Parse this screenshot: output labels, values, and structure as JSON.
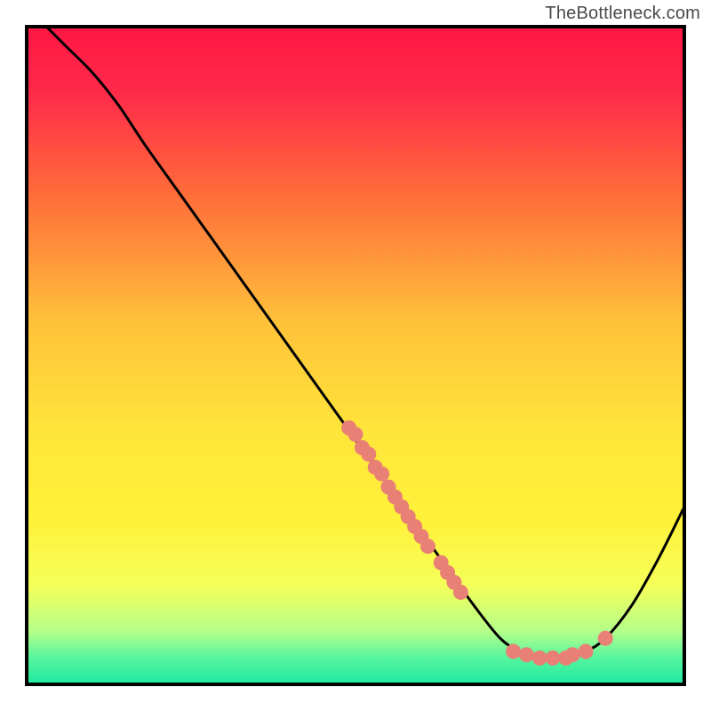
{
  "watermark": "TheBottleneck.com",
  "chart_data": {
    "type": "line",
    "title": "",
    "xlabel": "",
    "ylabel": "",
    "xlim": [
      0,
      100
    ],
    "ylim": [
      0,
      100
    ],
    "background": "rainbow-vertical-red-to-green",
    "curve": [
      {
        "x": 3,
        "y": 100
      },
      {
        "x": 6,
        "y": 97
      },
      {
        "x": 10,
        "y": 93
      },
      {
        "x": 14,
        "y": 88
      },
      {
        "x": 18,
        "y": 82
      },
      {
        "x": 23,
        "y": 75
      },
      {
        "x": 28,
        "y": 68
      },
      {
        "x": 33,
        "y": 61
      },
      {
        "x": 38,
        "y": 54
      },
      {
        "x": 43,
        "y": 47
      },
      {
        "x": 48,
        "y": 40
      },
      {
        "x": 53,
        "y": 33
      },
      {
        "x": 58,
        "y": 26
      },
      {
        "x": 63,
        "y": 19
      },
      {
        "x": 68,
        "y": 12
      },
      {
        "x": 72,
        "y": 7
      },
      {
        "x": 75,
        "y": 5
      },
      {
        "x": 78,
        "y": 4
      },
      {
        "x": 82,
        "y": 4
      },
      {
        "x": 85,
        "y": 5
      },
      {
        "x": 88,
        "y": 7
      },
      {
        "x": 92,
        "y": 12
      },
      {
        "x": 96,
        "y": 19
      },
      {
        "x": 100,
        "y": 27
      }
    ],
    "markers": [
      {
        "x": 49,
        "y": 39
      },
      {
        "x": 50,
        "y": 38
      },
      {
        "x": 51,
        "y": 36
      },
      {
        "x": 52,
        "y": 35
      },
      {
        "x": 53,
        "y": 33
      },
      {
        "x": 54,
        "y": 32
      },
      {
        "x": 55,
        "y": 30
      },
      {
        "x": 56,
        "y": 28.5
      },
      {
        "x": 57,
        "y": 27
      },
      {
        "x": 58,
        "y": 25.5
      },
      {
        "x": 59,
        "y": 24
      },
      {
        "x": 60,
        "y": 22.5
      },
      {
        "x": 61,
        "y": 21
      },
      {
        "x": 63,
        "y": 18.5
      },
      {
        "x": 64,
        "y": 17
      },
      {
        "x": 65,
        "y": 15.5
      },
      {
        "x": 66,
        "y": 14
      },
      {
        "x": 74,
        "y": 5
      },
      {
        "x": 76,
        "y": 4.5
      },
      {
        "x": 78,
        "y": 4
      },
      {
        "x": 80,
        "y": 4
      },
      {
        "x": 82,
        "y": 4
      },
      {
        "x": 83,
        "y": 4.5
      },
      {
        "x": 85,
        "y": 5
      },
      {
        "x": 88,
        "y": 7
      }
    ],
    "marker_color": "#e98076"
  }
}
